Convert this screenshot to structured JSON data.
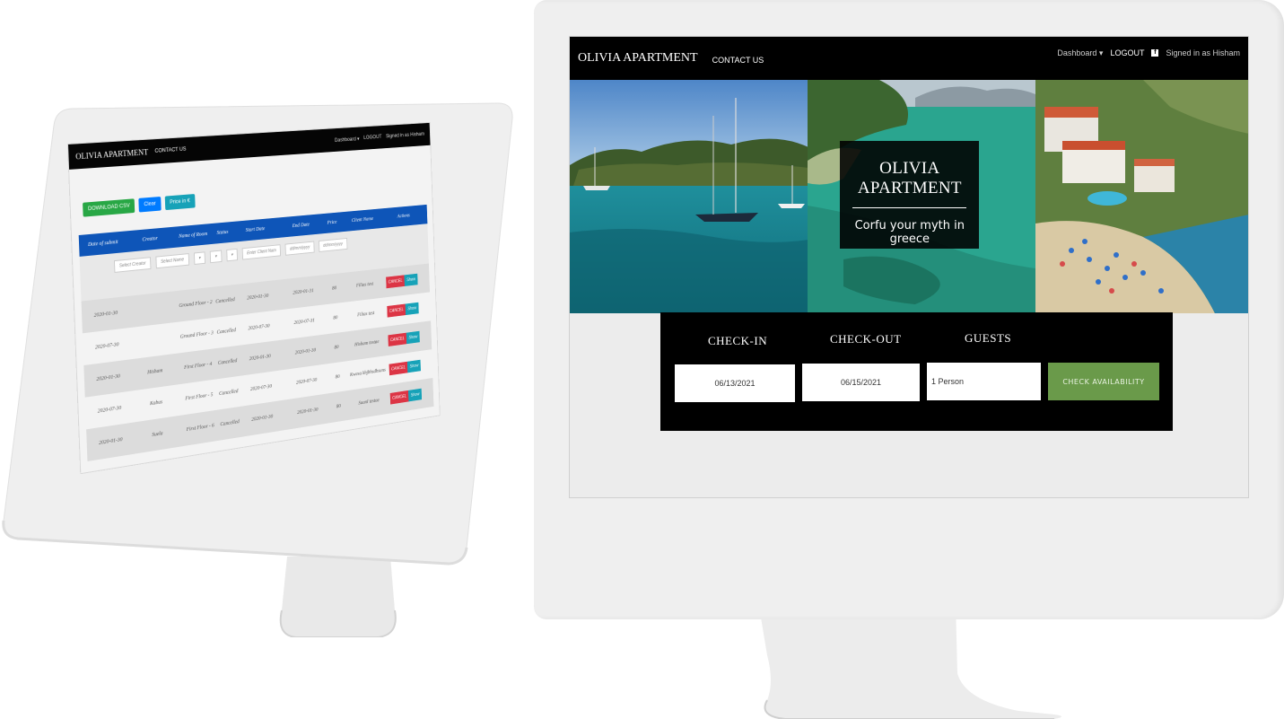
{
  "left_app": {
    "brand": "OLIVIA APARTMENT",
    "nav_link": "CONTACT US",
    "nav_right": [
      "Dashboard ▾",
      "LOGOUT",
      "Signed in as Hisham"
    ],
    "buttons": [
      "DOWNLOAD CSV",
      "Clear",
      "Price in €"
    ],
    "columns": [
      "Date of submit",
      "Creator",
      "Name of Room",
      "Status",
      "Start Date",
      "End Date",
      "Price",
      "Client Name",
      "Actions"
    ],
    "filters": [
      "Select Creator",
      "Select Name",
      "",
      "",
      "",
      "dd/mm/yyyy",
      "dd/mm/yyyy",
      "Enter Client Nam"
    ],
    "rows": [
      {
        "date": "2020-01-30",
        "creator": "",
        "room": "Ground Floor - 2",
        "status": "Cancelled",
        "start": "2020-01-30",
        "end": "2020-01-31",
        "price": "80",
        "client": "Filias test"
      },
      {
        "date": "2020-07-30",
        "creator": "",
        "room": "Ground Floor - 3",
        "status": "Cancelled",
        "start": "2020-07-30",
        "end": "2020-07-31",
        "price": "80",
        "client": "Filias test"
      },
      {
        "date": "2020-01-30",
        "creator": "Hisham",
        "room": "First Floor - 4",
        "status": "Cancelled",
        "start": "2020-01-30",
        "end": "2020-01-30",
        "price": "80",
        "client": "Hisham testae"
      },
      {
        "date": "2020-07-30",
        "creator": "Kabus",
        "room": "First Floor - 5",
        "status": "Cancelled",
        "start": "2020-07-30",
        "end": "2020-07-30",
        "price": "80",
        "client": "Kwesa khjbhsdbsuns"
      },
      {
        "date": "2020-01-30",
        "creator": "Suela",
        "room": "First Floor - 6",
        "status": "Cancelled",
        "start": "2020-01-30",
        "end": "2020-01-30",
        "price": "80",
        "client": "Suanl testae"
      }
    ],
    "cancel_label": "CANCEL",
    "show_label": "Show"
  },
  "right_app": {
    "brand": "OLIVIA APARTMENT",
    "nav_link": "CONTACT US",
    "nav_dashboard": "Dashboard ▾",
    "nav_logout": "LOGOUT",
    "nav_signed_in": "Signed in as Hisham",
    "hero_title": "OLIVIA APARTMENT",
    "hero_subtitle": "Corfu your myth in greece",
    "checkin_label": "CHECK-IN",
    "checkout_label": "CHECK-OUT",
    "guests_label": "GUESTS",
    "checkin_value": "06/13/2021",
    "checkout_value": "06/15/2021",
    "guests_value": "1 Person",
    "check_button": "CHECK AVAILABILITY"
  },
  "colors": {
    "nav_bg": "#000000",
    "table_header": "#0e55b8",
    "cancel_red": "#dc3545",
    "show_teal": "#17a2b8",
    "download_green": "#28a745",
    "check_green": "#6a9a4a"
  }
}
